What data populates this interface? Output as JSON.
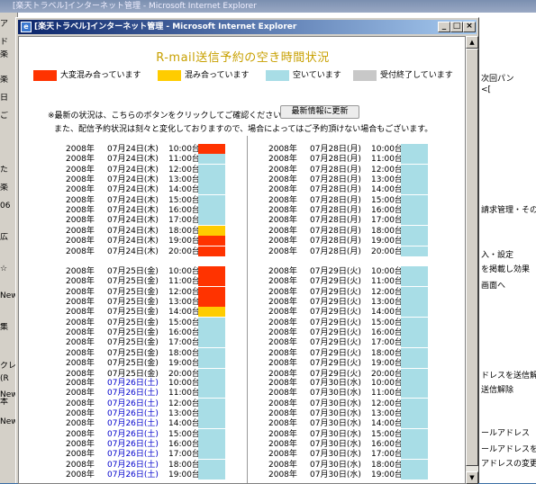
{
  "background_window": {
    "title": "[楽天トラベル]インターネット管理 - Microsoft Internet Explorer",
    "left_strip": [
      "ア",
      "ド",
      "楽",
      "楽",
      "日",
      "ご",
      "た",
      "楽",
      "06",
      "広",
      "☆",
      "New",
      "集",
      "クレ",
      "(R",
      "New",
      "本",
      "New"
    ],
    "right_items": [
      "次回パン",
      "<[",
      "請求管理・その",
      "入・設定",
      "を掲載し効果",
      "画面へ",
      "ドレスを送信解",
      "送信解除",
      "ールアドレス",
      "ールアドレスを変",
      "アドレスの変更"
    ]
  },
  "window": {
    "title": "[楽天トラベル]インターネット管理 - Microsoft Internet Explorer",
    "buttons": {
      "minimize": "_",
      "maximize": "□",
      "close": "×"
    }
  },
  "page": {
    "heading": "R-mail送信予約の空き時間状況",
    "legend": [
      {
        "label": "大変混み合っています",
        "color": "#ff3300"
      },
      {
        "label": "混み合っています",
        "color": "#ffcc00"
      },
      {
        "label": "空いています",
        "color": "#a8dde6"
      },
      {
        "label": "受付終了しています",
        "color": "#c8c8c8"
      }
    ],
    "note_line1": "※最新の状況は、こちらのボタンをクリックしてご確認ください。",
    "refresh_button": "最新情報に更新",
    "note_line2": "また、配信予約状況は刻々と変化しておりますので、場合によってはご予約頂けない場合もございます。"
  },
  "colors": {
    "busy_very": "#ff3300",
    "busy": "#ffcc00",
    "free": "#a8dde6",
    "closed": "#c8c8c8"
  },
  "schedule": {
    "left": [
      {
        "date": "07月24日(木)",
        "sat": false,
        "slots": [
          {
            "year": "2008年",
            "time": "10:00台",
            "status": "busy_very"
          },
          {
            "year": "2008年",
            "time": "11:00台",
            "status": "free"
          },
          {
            "year": "2008年",
            "time": "12:00台",
            "status": "free"
          },
          {
            "year": "2008年",
            "time": "13:00台",
            "status": "free"
          },
          {
            "year": "2008年",
            "time": "14:00台",
            "status": "free"
          },
          {
            "year": "2008年",
            "time": "15:00台",
            "status": "free"
          },
          {
            "year": "2008年",
            "time": "16:00台",
            "status": "free"
          },
          {
            "year": "2008年",
            "time": "17:00台",
            "status": "free"
          },
          {
            "year": "2008年",
            "time": "18:00台",
            "status": "busy"
          },
          {
            "year": "2008年",
            "time": "19:00台",
            "status": "busy_very"
          },
          {
            "year": "2008年",
            "time": "20:00台",
            "status": "busy_very"
          }
        ]
      },
      {
        "date": "07月25日(金)",
        "sat": false,
        "slots": [
          {
            "year": "2008年",
            "time": "10:00台",
            "status": "busy_very"
          },
          {
            "year": "2008年",
            "time": "11:00台",
            "status": "busy_very"
          },
          {
            "year": "2008年",
            "time": "12:00台",
            "status": "busy_very"
          },
          {
            "year": "2008年",
            "time": "13:00台",
            "status": "busy_very"
          },
          {
            "year": "2008年",
            "time": "14:00台",
            "status": "busy"
          },
          {
            "year": "2008年",
            "time": "15:00台",
            "status": "free"
          },
          {
            "year": "2008年",
            "time": "16:00台",
            "status": "free"
          },
          {
            "year": "2008年",
            "time": "17:00台",
            "status": "free"
          },
          {
            "year": "2008年",
            "time": "18:00台",
            "status": "free"
          },
          {
            "year": "2008年",
            "time": "19:00台",
            "status": "free"
          },
          {
            "year": "2008年",
            "time": "20:00台",
            "status": "free"
          }
        ]
      },
      {
        "date": "07月26日(土)",
        "sat": true,
        "slots": [
          {
            "year": "2008年",
            "time": "10:00台",
            "status": "free"
          },
          {
            "year": "2008年",
            "time": "11:00台",
            "status": "free"
          },
          {
            "year": "2008年",
            "time": "12:00台",
            "status": "free"
          },
          {
            "year": "2008年",
            "time": "13:00台",
            "status": "free"
          },
          {
            "year": "2008年",
            "time": "14:00台",
            "status": "free"
          },
          {
            "year": "2008年",
            "time": "15:00台",
            "status": "free"
          },
          {
            "year": "2008年",
            "time": "16:00台",
            "status": "free"
          },
          {
            "year": "2008年",
            "time": "17:00台",
            "status": "free"
          },
          {
            "year": "2008年",
            "time": "18:00台",
            "status": "free"
          },
          {
            "year": "2008年",
            "time": "19:00台",
            "status": "free"
          }
        ]
      }
    ],
    "right": [
      {
        "date": "07月28日(月)",
        "sat": false,
        "slots": [
          {
            "year": "2008年",
            "time": "10:00台",
            "status": "free"
          },
          {
            "year": "2008年",
            "time": "11:00台",
            "status": "free"
          },
          {
            "year": "2008年",
            "time": "12:00台",
            "status": "free"
          },
          {
            "year": "2008年",
            "time": "13:00台",
            "status": "free"
          },
          {
            "year": "2008年",
            "time": "14:00台",
            "status": "free"
          },
          {
            "year": "2008年",
            "time": "15:00台",
            "status": "free"
          },
          {
            "year": "2008年",
            "time": "16:00台",
            "status": "free"
          },
          {
            "year": "2008年",
            "time": "17:00台",
            "status": "free"
          },
          {
            "year": "2008年",
            "time": "18:00台",
            "status": "free"
          },
          {
            "year": "2008年",
            "time": "19:00台",
            "status": "free"
          },
          {
            "year": "2008年",
            "time": "20:00台",
            "status": "free"
          }
        ]
      },
      {
        "date": "07月29日(火)",
        "sat": false,
        "slots": [
          {
            "year": "2008年",
            "time": "10:00台",
            "status": "free"
          },
          {
            "year": "2008年",
            "time": "11:00台",
            "status": "free"
          },
          {
            "year": "2008年",
            "time": "12:00台",
            "status": "free"
          },
          {
            "year": "2008年",
            "time": "13:00台",
            "status": "free"
          },
          {
            "year": "2008年",
            "time": "14:00台",
            "status": "free"
          },
          {
            "year": "2008年",
            "time": "15:00台",
            "status": "free"
          },
          {
            "year": "2008年",
            "time": "16:00台",
            "status": "free"
          },
          {
            "year": "2008年",
            "time": "17:00台",
            "status": "free"
          },
          {
            "year": "2008年",
            "time": "18:00台",
            "status": "free"
          },
          {
            "year": "2008年",
            "time": "19:00台",
            "status": "free"
          },
          {
            "year": "2008年",
            "time": "20:00台",
            "status": "free"
          }
        ]
      },
      {
        "date": "07月30日(水)",
        "sat": false,
        "slots": [
          {
            "year": "2008年",
            "time": "10:00台",
            "status": "free"
          },
          {
            "year": "2008年",
            "time": "11:00台",
            "status": "free"
          },
          {
            "year": "2008年",
            "time": "12:00台",
            "status": "free"
          },
          {
            "year": "2008年",
            "time": "13:00台",
            "status": "free"
          },
          {
            "year": "2008年",
            "time": "14:00台",
            "status": "free"
          },
          {
            "year": "2008年",
            "time": "15:00台",
            "status": "free"
          },
          {
            "year": "2008年",
            "time": "16:00台",
            "status": "free"
          },
          {
            "year": "2008年",
            "time": "17:00台",
            "status": "free"
          },
          {
            "year": "2008年",
            "time": "18:00台",
            "status": "free"
          },
          {
            "year": "2008年",
            "time": "19:00台",
            "status": "free"
          }
        ]
      }
    ]
  }
}
